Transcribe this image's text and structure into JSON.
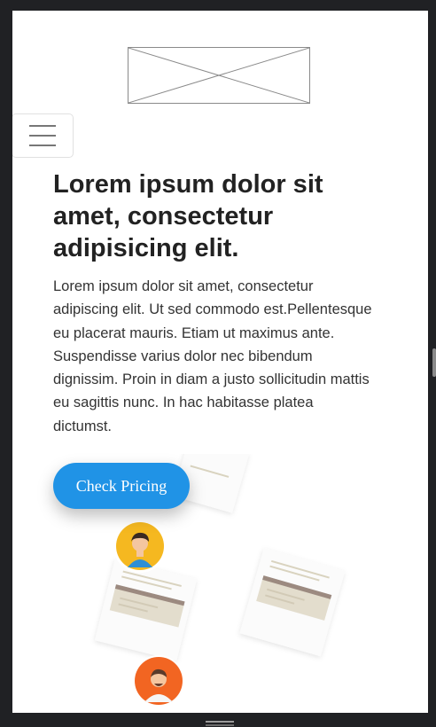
{
  "hero": {
    "title": "Lorem ipsum dolor sit amet, consectetur adipisicing elit.",
    "body": "Lorem ipsum dolor sit amet, consectetur adipiscing elit. Ut sed commodo est.Pellentesque eu placerat mauris. Etiam ut maximus ante. Suspendisse varius dolor nec bibendum dignissim. Proin in diam a justo sollicitudin mattis eu sagittis nunc. In hac habitasse platea dictumst."
  },
  "cta": {
    "label": "Check Pricing"
  },
  "icons": {
    "menu": "hamburger-menu-icon",
    "logo": "image-placeholder-icon",
    "avatar_1": "user-avatar-icon",
    "avatar_2": "user-avatar-icon"
  },
  "colors": {
    "accent": "#2093e6",
    "title": "#222222",
    "text": "#333333",
    "avatar_1_bg": "#f5b820",
    "avatar_2_bg": "#f26522"
  }
}
